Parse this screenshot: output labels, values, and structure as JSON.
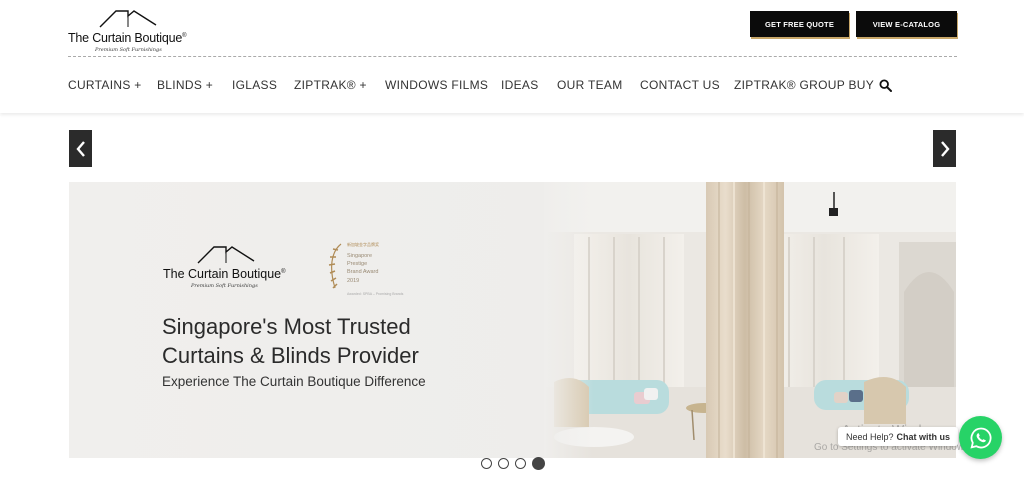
{
  "header": {
    "logo": {
      "brand": "The Curtain Boutique",
      "reg": "®",
      "tagline": "Premium Soft Furnishings"
    },
    "buttons": {
      "quote": "GET FREE QUOTE",
      "catalog": "VIEW E-CATALOG"
    },
    "nav": [
      {
        "label": "CURTAINS +"
      },
      {
        "label": "BLINDS +"
      },
      {
        "label": "IGLASS"
      },
      {
        "label": "ZIPTRAK® +"
      },
      {
        "label": "WINDOWS FILMS"
      },
      {
        "label": "IDEAS"
      },
      {
        "label": "OUR TEAM"
      },
      {
        "label": "CONTACT US"
      },
      {
        "label": "ZIPTRAK® GROUP BUY"
      }
    ],
    "search_icon": "search-icon"
  },
  "slider": {
    "logo": {
      "brand": "The Curtain Boutique",
      "reg": "®",
      "tagline": "Premium Soft Furnishings"
    },
    "award": {
      "chinese": "新加坡金字品牌奖",
      "line1": "Singapore",
      "line2": "Prestige",
      "line3": "Brand Award",
      "year": "2019",
      "sub": "Awarded: SPBA – Promising Brands"
    },
    "headline_line1": "Singapore's Most Trusted",
    "headline_line2": "Curtains & Blinds Provider",
    "subline": "Experience The Curtain Boutique Difference",
    "dots_total": 4,
    "active_dot": 4
  },
  "watermark": {
    "line1": "Activate Windows",
    "line2": "Go to Settings to activate Windows."
  },
  "whatsapp": {
    "help_text": "Need Help?",
    "chat_text": "Chat with us",
    "icon": "whatsapp-icon"
  },
  "colors": {
    "button_bg": "#0b0b0b",
    "button_accent": "#c9a86a",
    "whatsapp_green": "#27d367",
    "arrow_bg": "#2b2b2b"
  }
}
